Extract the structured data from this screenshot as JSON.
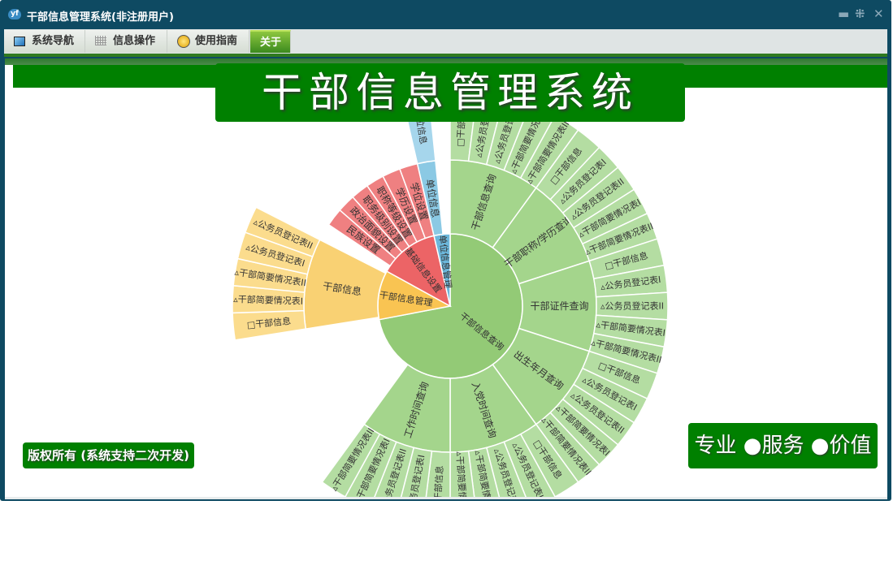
{
  "window": {
    "title": "干部信息管理系统(非注册用户)",
    "app_icon": "yf",
    "controls": {
      "minimize": "▬",
      "restore": "⁜",
      "close": "✕"
    }
  },
  "tabs": [
    {
      "label": "系统导航",
      "icon": "monitor-icon"
    },
    {
      "label": "信息操作",
      "icon": "grid-icon"
    },
    {
      "label": "使用指南",
      "icon": "help-icon"
    },
    {
      "label": "关于",
      "icon": "",
      "active": true
    }
  ],
  "banner": {
    "title": "干部信息管理系统"
  },
  "footer": {
    "copyright": "版权所有 (系统支持二次开发)",
    "slogan": "专业 ●服务 ●价值"
  },
  "colors": {
    "brand_green": "#008000",
    "window": "#0e4a62"
  },
  "chart_data": {
    "type": "sunburst",
    "unit_note": "leaf value 1",
    "root": [
      {
        "name": "干部信息查询",
        "value": 36,
        "align": "start",
        "colors": [
          "#93ca76",
          "#a4d58c",
          "#b4dda2"
        ],
        "children": [
          {
            "name": "干部信息查询",
            "value": 5,
            "children": [
              "□干部信息",
              "▵公务员登记表I",
              "▵公务员登记表II",
              "▵干部简要情况表I",
              "▵干部简要情况表II"
            ]
          },
          {
            "name": "干部职称/学历查询",
            "value": 5,
            "children": [
              "□干部信息",
              "▵公务员登记表I",
              "▵公务员登记表II",
              "▵干部简要情况表I",
              "▵干部简要情况表II"
            ]
          },
          {
            "name": "干部证件查询",
            "value": 5,
            "children": [
              "□干部信息",
              "▵公务员登记表I",
              "▵公务员登记表II",
              "▵干部简要情况表I",
              "▵干部简要情况表II"
            ]
          },
          {
            "name": "出生年月查询",
            "value": 5,
            "children": [
              "□干部信息",
              "▵公务员登记表I",
              "▵公务员登记表II",
              "▵干部简要情况表I",
              "▵干部简要情况表II"
            ]
          },
          {
            "name": "入党时间查询",
            "value": 5,
            "children": [
              "□干部信息",
              "▵公务员登记表I",
              "▵公务员登记表II",
              "▵干部简要情况表I",
              "▵干部简要情况表II"
            ]
          },
          {
            "name": "工作时间查询",
            "value": 5,
            "children": [
              "□干部信息",
              "▵公务员登记表I",
              "▵公务员登记表II",
              "▵干部简要情况表I",
              "▵干部简要情况表II"
            ]
          }
        ]
      },
      {
        "name": "干部信息管理",
        "value": 5.5,
        "align": "center",
        "colors": [
          "#f9c452",
          "#f9d173",
          "#fbdc8d"
        ],
        "children": [
          {
            "name": "干部信息",
            "value": 5,
            "children": [
              "□干部信息",
              "▵干部简要情况表I",
              "▵干部简要情况表II",
              "▵公务员登记表I",
              "▵公务员登记表II"
            ]
          }
        ]
      },
      {
        "name": "基础信息设置",
        "value": 6.7,
        "align": "end",
        "colors": [
          "#ec6466",
          "#ef8081",
          "#ef8081"
        ],
        "children": [
          {
            "name": "民族设置",
            "value": 1
          },
          {
            "name": "政治面貌设置",
            "value": 1
          },
          {
            "name": "职务级别设置",
            "value": 1
          },
          {
            "name": "职称等级设置",
            "value": 1
          },
          {
            "name": "学历设置",
            "value": 1
          },
          {
            "name": "学位设置",
            "value": 1
          }
        ]
      },
      {
        "name": "单位信息管理",
        "value": 1.8,
        "align": "start",
        "colors": [
          "#6cb7db",
          "#8bc9e4",
          "#a6d6ec"
        ],
        "children": [
          {
            "name": "单位信息",
            "value": 1,
            "children": [
              "单位信息"
            ]
          }
        ]
      }
    ]
  }
}
